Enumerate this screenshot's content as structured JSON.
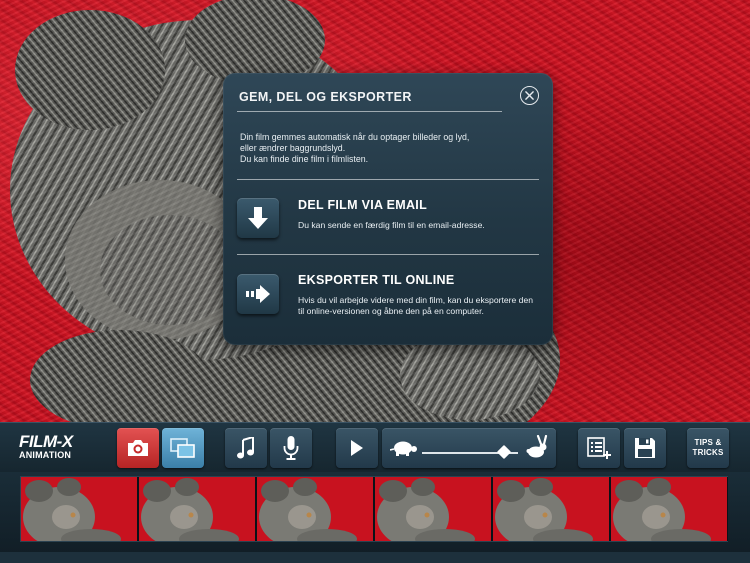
{
  "dialog": {
    "title": "GEM, DEL OG EKSPORTER",
    "intro": [
      "Din film gemmes automatisk når du optager billeder og lyd,",
      "eller ændrer baggrundslyd.",
      "Du kan finde dine film i filmlisten."
    ],
    "email": {
      "title": "DEL FILM VIA EMAIL",
      "text": "Du kan sende en færdig film til en email-adresse.",
      "icon": "arrow-down-icon"
    },
    "export": {
      "title": "EKSPORTER TIL ONLINE",
      "text": "Hvis du vil arbejde videre med din film, kan du eksportere den til online-versionen og åbne den på en computer.",
      "icon": "arrow-right-icon"
    },
    "close_icon": "close-icon"
  },
  "toolbar": {
    "logo_main": "FILM-X",
    "logo_sub": "ANIMATION",
    "tips_line1": "TIPS &",
    "tips_line2": "TRICKS",
    "speed_level": 0.85,
    "icons": [
      "camera-icon",
      "onion-skin-icon",
      "music-note-icon",
      "microphone-icon",
      "play-icon",
      "turtle-icon",
      "rabbit-icon",
      "frame-list-icon",
      "save-icon"
    ]
  },
  "filmstrip": {
    "frame_count": 6
  },
  "colors": {
    "accent_red": "#d0202a",
    "accent_blue": "#5aa3cc",
    "panel_dark": "#1b2e3a"
  }
}
